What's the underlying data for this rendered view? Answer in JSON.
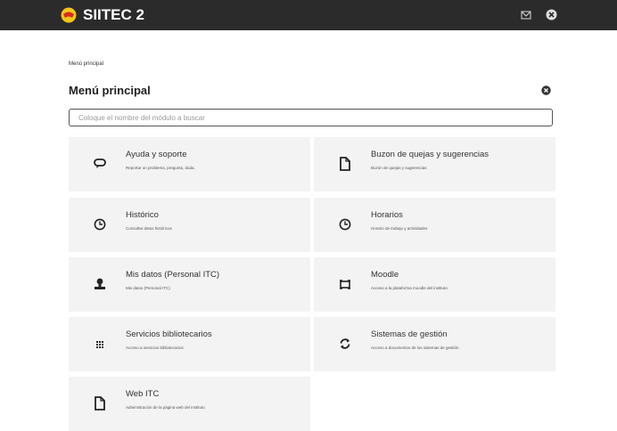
{
  "header": {
    "app_name": "SIITEC 2",
    "icons": [
      "logo-icon",
      "mail-icon",
      "close-icon"
    ],
    "bg_color": "#2b2b2b"
  },
  "breadcrumb": "Menú principal",
  "page_title": "Menú principal",
  "search": {
    "placeholder": "Coloque el nombre del módulo a buscar"
  },
  "modules": [
    {
      "title": "Ayuda y soporte",
      "subtitle": "Reportar un problema, pregunta, duda.",
      "icon": "chat-icon"
    },
    {
      "title": "Buzon de quejas y sugerencias",
      "subtitle": "Buzón de quejas y sugerencias",
      "icon": "document-icon"
    },
    {
      "title": "Histórico",
      "subtitle": "Consultar datos históricos",
      "icon": "clock-icon"
    },
    {
      "title": "Horarios",
      "subtitle": "Horario de trabajo y actividades",
      "icon": "clock-icon"
    },
    {
      "title": "Mis datos (Personal ITC)",
      "subtitle": "Mis datos (Personal ITC)",
      "icon": "person-icon"
    },
    {
      "title": "Moodle",
      "subtitle": "Acceso a la plataforma moodle del instituto",
      "icon": "moodle-icon"
    },
    {
      "title": "Servicios bibliotecarios",
      "subtitle": "Acceso a servicios bibliotecarios",
      "icon": "grid-icon"
    },
    {
      "title": "Sistemas de gestión",
      "subtitle": "Acceso a documentos de los sistemas de gestión",
      "icon": "refresh-icon"
    },
    {
      "title": "Web ITC",
      "subtitle": "Administración de la página web del instituto",
      "icon": "document-icon"
    }
  ]
}
